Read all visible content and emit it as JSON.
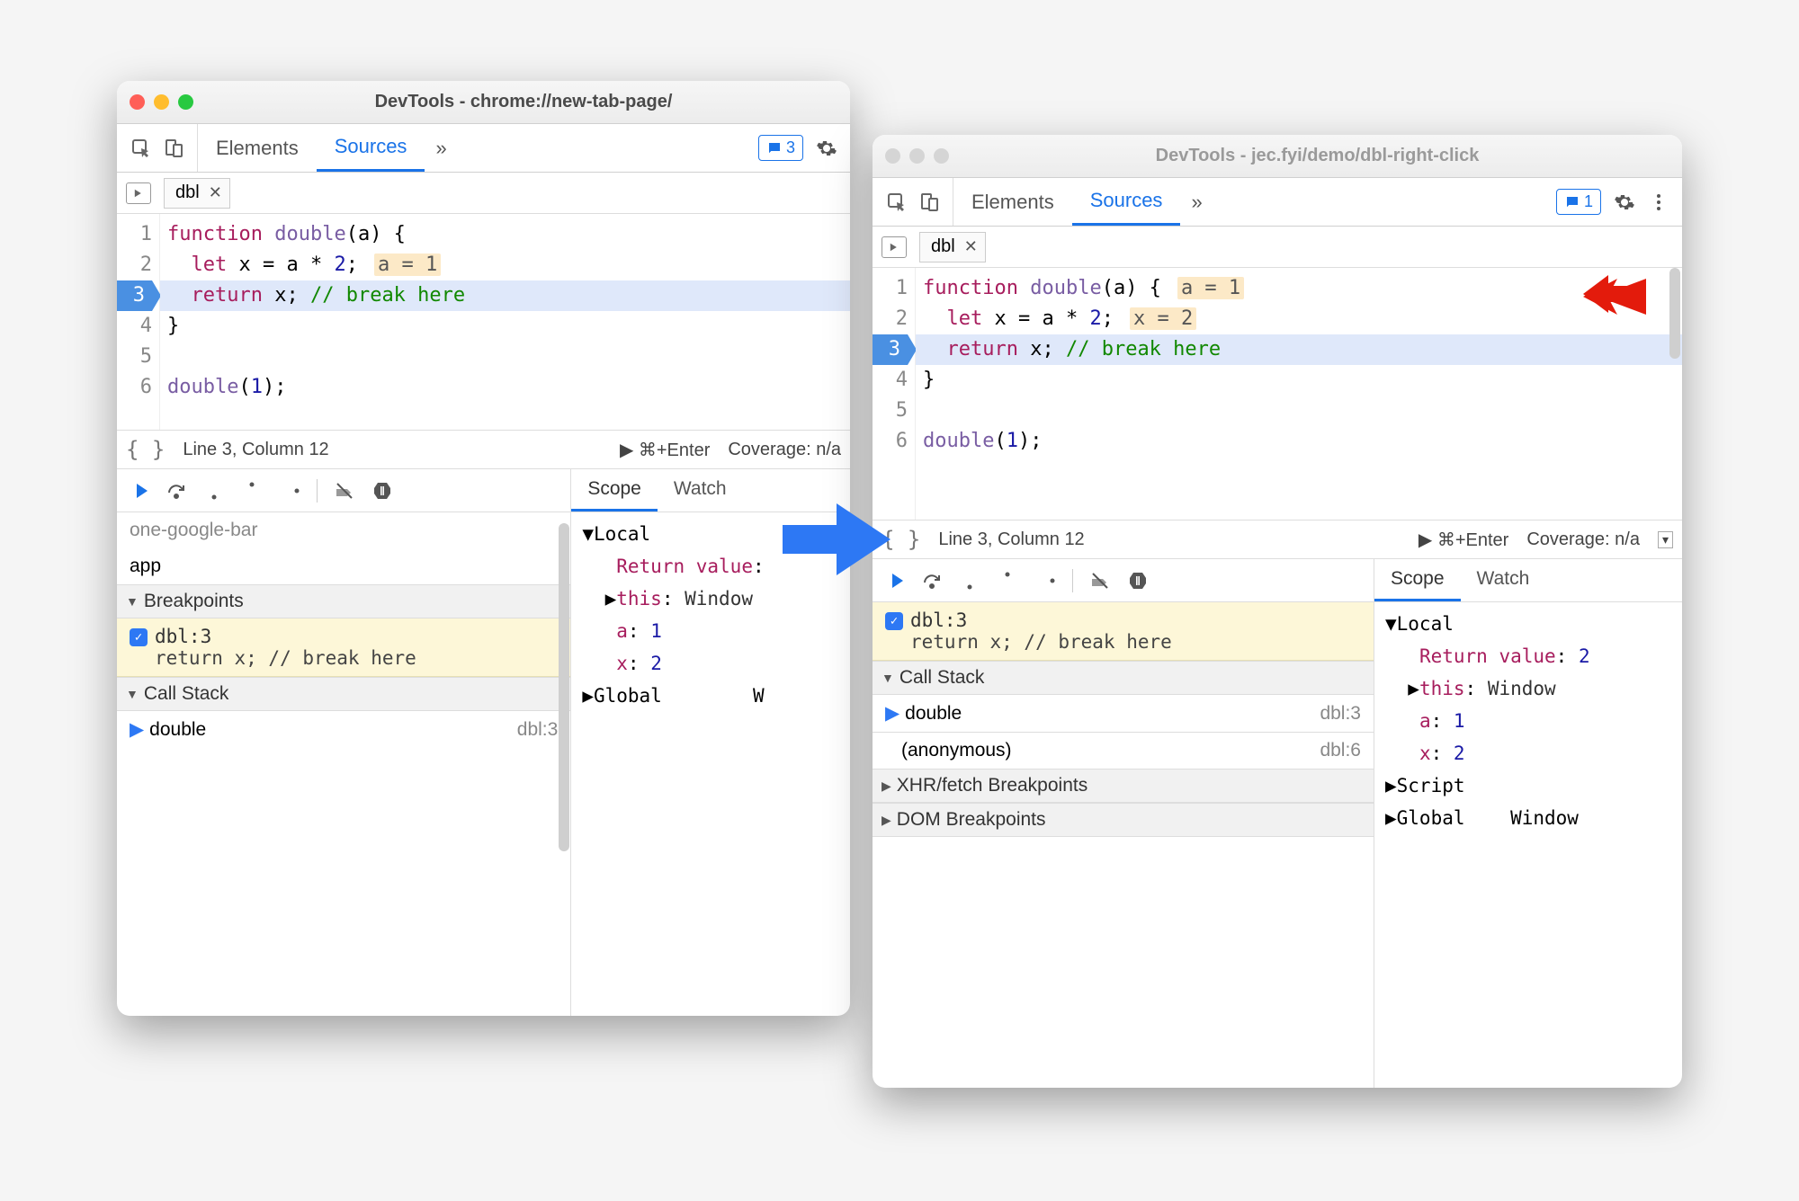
{
  "left": {
    "title": "DevTools - chrome://new-tab-page/",
    "tabs": {
      "elements": "Elements",
      "sources": "Sources"
    },
    "feedback_count": "3",
    "file_tab": "dbl",
    "code": {
      "lines": [
        {
          "n": "1",
          "html": "<span class='kw'>function</span> <span class='fn'>double</span>(a) {"
        },
        {
          "n": "2",
          "html": "  <span class='kw'>let</span> x = a * <span class='num'>2</span>;",
          "inline": "a = 1"
        },
        {
          "n": "3",
          "html": "  <span class='kw'>return</span> x; <span class='cm'>// break here</span>",
          "bp": true,
          "hl": true
        },
        {
          "n": "4",
          "html": "}"
        },
        {
          "n": "5",
          "html": ""
        },
        {
          "n": "6",
          "html": "<span class='fn'>double</span>(<span class='num'>1</span>);"
        }
      ]
    },
    "status": {
      "pos": "Line 3, Column 12",
      "run": "▶ ⌘+Enter",
      "cov": "Coverage: n/a"
    },
    "sections": {
      "app_label": "app",
      "breakpoints": "Breakpoints",
      "bp_item_title": "dbl:3",
      "bp_item_code": "return x; // break here",
      "callstack": "Call Stack",
      "frame": "double",
      "frame_loc": "dbl:3"
    },
    "scope": {
      "tab_scope": "Scope",
      "tab_watch": "Watch",
      "rows": [
        "▼Local",
        "   Return value:",
        "  ▶this: Window",
        "   a: 1",
        "   x: 2",
        "▶Global        W"
      ]
    }
  },
  "right": {
    "title": "DevTools - jec.fyi/demo/dbl-right-click",
    "tabs": {
      "elements": "Elements",
      "sources": "Sources"
    },
    "feedback_count": "1",
    "file_tab": "dbl",
    "code": {
      "lines": [
        {
          "n": "1",
          "html": "<span class='kw'>function</span> <span class='fn'>double</span>(a) {",
          "inline": "a = 1"
        },
        {
          "n": "2",
          "html": "  <span class='kw'>let</span> x = a * <span class='num'>2</span>;",
          "inline": "x = 2"
        },
        {
          "n": "3",
          "html": "  <span class='kw'>return</span> x; <span class='cm'>// break here</span>",
          "bp": true,
          "hl": true
        },
        {
          "n": "4",
          "html": "}"
        },
        {
          "n": "5",
          "html": ""
        },
        {
          "n": "6",
          "html": "<span class='fn'>double</span>(<span class='num'>1</span>);"
        }
      ]
    },
    "status": {
      "pos": "Line 3, Column 12",
      "run": "▶ ⌘+Enter",
      "cov": "Coverage: n/a"
    },
    "sections": {
      "bp_item_title": "dbl:3",
      "bp_item_code": "return x; // break here",
      "callstack": "Call Stack",
      "frame1": "double",
      "frame1_loc": "dbl:3",
      "frame2": "(anonymous)",
      "frame2_loc": "dbl:6",
      "xhr": "XHR/fetch Breakpoints",
      "dom": "DOM Breakpoints"
    },
    "scope": {
      "tab_scope": "Scope",
      "tab_watch": "Watch",
      "rows": [
        "▼Local",
        "   Return value: 2",
        "  ▶this: Window",
        "   a: 1",
        "   x: 2",
        "▶Script",
        "▶Global    Window"
      ]
    }
  }
}
